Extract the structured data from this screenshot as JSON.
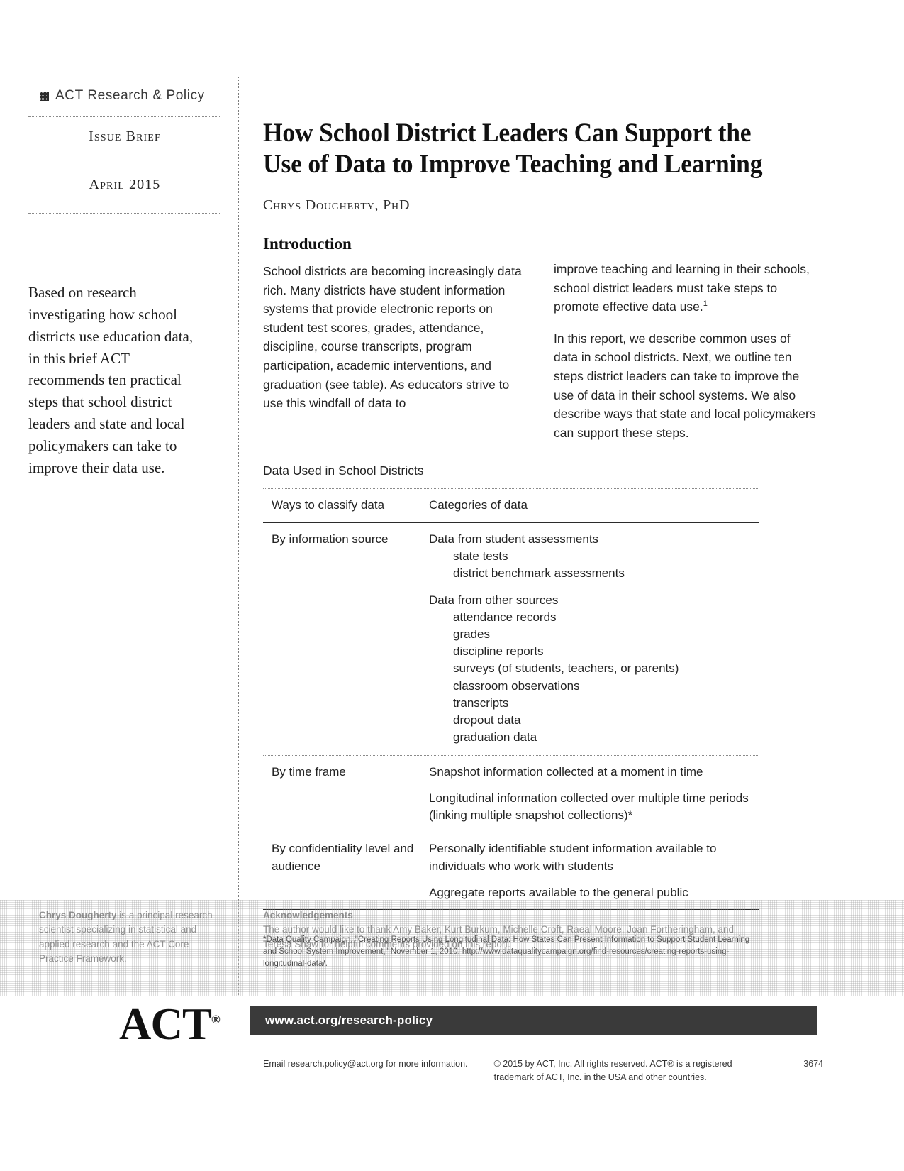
{
  "sidebar": {
    "brand": "ACT Research & Policy",
    "brand_mark_icon": "act-checker-mark-icon",
    "issue_label": "Issue Brief",
    "date_label": "April 2015",
    "blurb": "Based on research investigating how school districts use education data, in this brief ACT recommends ten practical steps that school district leaders and state and local policymakers can take to improve their data use."
  },
  "main": {
    "title": "How School District Leaders Can Support the Use of Data to Improve Teaching and Learning",
    "byline": "Chrys Dougherty, PhD",
    "section_head": "Introduction",
    "col_left": [
      "School districts are becoming increasingly data rich. Many districts have student information systems that provide electronic reports on student test scores, grades, attendance, discipline, course transcripts, program participation, academic interventions, and graduation (see table). As educators strive to use this windfall of data to"
    ],
    "col_right": [
      "improve teaching and learning in their schools, school district leaders must take steps to promote effective data use.",
      "In this report, we describe common uses of data in school districts. Next, we outline ten steps district leaders can take to improve the use of data in their school systems. We also describe ways that state and local policymakers can support these steps."
    ],
    "footnote_marker": "1"
  },
  "table": {
    "caption": "Data Used in School Districts",
    "headers": [
      "Ways to classify data",
      "Categories of data"
    ],
    "rows": [
      {
        "label": "By information source",
        "groups": [
          {
            "title": "Data from student assessments",
            "items": [
              "state tests",
              "district benchmark assessments"
            ]
          },
          {
            "title": "Data from other sources",
            "items": [
              "attendance records",
              "grades",
              "discipline reports",
              "surveys (of students, teachers, or parents)",
              "classroom observations",
              "transcripts",
              "dropout data",
              "graduation data"
            ]
          }
        ]
      },
      {
        "label": "By time frame",
        "paras": [
          "Snapshot information collected at a moment in time",
          "Longitudinal information collected over multiple time periods (linking multiple snapshot collections)*"
        ]
      },
      {
        "label": "By confidentiality level and audience",
        "paras": [
          "Personally identifiable student information available to individuals who work with students",
          "Aggregate reports available to the general public"
        ]
      }
    ],
    "footnote": "*Data Quality Campaign. \"Creating Reports Using Longitudinal Data: How States Can Present Information to Support Student Learning and School System Improvement,\" November 1, 2010, http://www.dataqualitycampaign.org/find-resources/creating-reports-using-longitudinal-data/."
  },
  "acknowledgements": {
    "left_bold": "Chrys Dougherty",
    "left_rest": " is a principal research scientist specializing in statistical and applied research and the ACT Core Practice Framework.",
    "right_heading": "Acknowledgements",
    "right_body": "The author would like to thank Amy Baker, Kurt Burkum, Michelle Croft, Raeal Moore, Joan Fortheringham, and Teresa Shaw for helpful comments provided on this report."
  },
  "footer": {
    "logo": "ACT",
    "logo_tm": "®",
    "url": "www.act.org/research-policy",
    "email_line": "Email research.policy@act.org for more information.",
    "copyright": "© 2015 by ACT, Inc. All rights reserved. ACT® is a registered trademark of ACT, Inc. in the USA and other countries.",
    "doc_number": "3674"
  }
}
